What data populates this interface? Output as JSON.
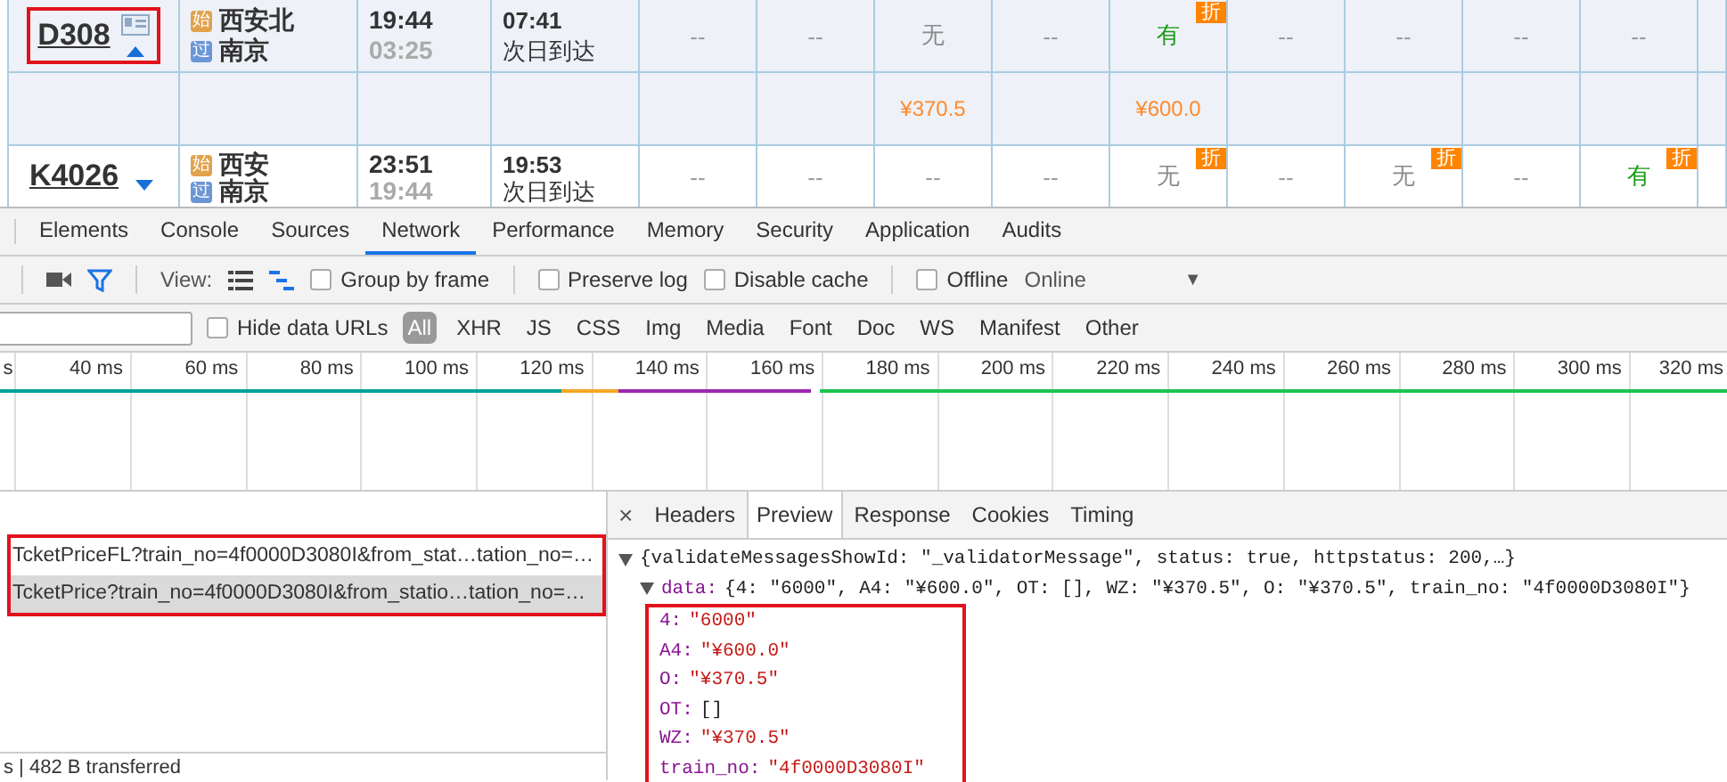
{
  "trains": [
    {
      "number": "D308",
      "info_icon": true,
      "expanded": true,
      "annotated": true,
      "from": {
        "badge": "始",
        "name": "西安北"
      },
      "to": {
        "badge": "过",
        "name": "南京"
      },
      "depart": "19:44",
      "duration": "03:25",
      "arrive": "07:41",
      "arrive_note": "次日到达",
      "seats": [
        {
          "text": "--",
          "kind": "dash"
        },
        {
          "text": "--",
          "kind": "dash"
        },
        {
          "text": "无",
          "kind": "none",
          "price": "¥370.5"
        },
        {
          "text": "--",
          "kind": "dash"
        },
        {
          "text": "有",
          "kind": "available",
          "discount": "折",
          "price": "¥600.0"
        },
        {
          "text": "--",
          "kind": "dash"
        },
        {
          "text": "--",
          "kind": "dash"
        },
        {
          "text": "--",
          "kind": "dash"
        },
        {
          "text": "--",
          "kind": "dash"
        }
      ]
    },
    {
      "number": "K4026",
      "info_icon": false,
      "expanded": false,
      "annotated": false,
      "from": {
        "badge": "始",
        "name": "西安"
      },
      "to": {
        "badge": "过",
        "name": "南京"
      },
      "depart": "23:51",
      "duration": "19:44",
      "arrive": "19:53",
      "arrive_note": "次日到达",
      "seats": [
        {
          "text": "--",
          "kind": "dash"
        },
        {
          "text": "--",
          "kind": "dash"
        },
        {
          "text": "--",
          "kind": "dash"
        },
        {
          "text": "--",
          "kind": "dash"
        },
        {
          "text": "无",
          "kind": "none",
          "discount": "折"
        },
        {
          "text": "--",
          "kind": "dash"
        },
        {
          "text": "无",
          "kind": "none",
          "discount": "折"
        },
        {
          "text": "--",
          "kind": "dash"
        },
        {
          "text": "有",
          "kind": "available",
          "discount": "折"
        }
      ]
    }
  ],
  "devtools": {
    "tabs": [
      {
        "label": "Elements",
        "selected": false
      },
      {
        "label": "Console",
        "selected": false
      },
      {
        "label": "Sources",
        "selected": false
      },
      {
        "label": "Network",
        "selected": true
      },
      {
        "label": "Performance",
        "selected": false
      },
      {
        "label": "Memory",
        "selected": false
      },
      {
        "label": "Security",
        "selected": false
      },
      {
        "label": "Application",
        "selected": false
      },
      {
        "label": "Audits",
        "selected": false
      }
    ],
    "filter_active": true,
    "view_label": "View:",
    "view_modes": [
      {
        "selected": false
      },
      {
        "selected": true
      }
    ],
    "checkboxes": [
      {
        "label": "Group by frame",
        "checked": false
      },
      {
        "label": "Preserve log",
        "checked": false
      },
      {
        "label": "Disable cache",
        "checked": false
      },
      {
        "label": "Offline",
        "checked": false
      }
    ],
    "throttle": {
      "value": "Online",
      "caret": "▼"
    },
    "hide_data_urls": {
      "label": "Hide data URLs",
      "checked": false
    },
    "types": [
      {
        "label": "All",
        "selected": true
      },
      {
        "label": "XHR",
        "selected": false
      },
      {
        "label": "JS",
        "selected": false
      },
      {
        "label": "CSS",
        "selected": false
      },
      {
        "label": "Img",
        "selected": false
      },
      {
        "label": "Media",
        "selected": false
      },
      {
        "label": "Font",
        "selected": false
      },
      {
        "label": "Doc",
        "selected": false
      },
      {
        "label": "WS",
        "selected": false
      },
      {
        "label": "Manifest",
        "selected": false
      },
      {
        "label": "Other",
        "selected": false
      }
    ],
    "ruler": [
      "s",
      "40 ms",
      "60 ms",
      "80 ms",
      "100 ms",
      "120 ms",
      "140 ms",
      "160 ms",
      "180 ms",
      "200 ms",
      "220 ms",
      "240 ms",
      "260 ms",
      "280 ms",
      "300 ms",
      "320 ms"
    ],
    "requests_annotated": true,
    "requests": [
      {
        "name": "TcketPriceFL?train_no=4f0000D3080I&from_stat…tation_no=…",
        "selected": false
      },
      {
        "name": "TcketPrice?train_no=4f0000D3080I&from_statio…tation_no=…",
        "selected": true
      }
    ],
    "status": "s | 482 B transferred",
    "preview": {
      "close": "×",
      "tabs": [
        {
          "label": "Headers",
          "selected": false
        },
        {
          "label": "Preview",
          "selected": true
        },
        {
          "label": "Response",
          "selected": false
        },
        {
          "label": "Cookies",
          "selected": false
        },
        {
          "label": "Timing",
          "selected": false
        }
      ],
      "root": {
        "text": "{validateMessagesShowId: \"_validatorMessage\", status: true, httpstatus: 200,…}",
        "expanded": true
      },
      "data": {
        "key": "data:",
        "summary": "{4: \"6000\", A4: \"¥600.0\", OT: [], WZ: \"¥370.5\", O: \"¥370.5\", train_no: \"4f0000D3080I\"}",
        "expanded": true,
        "annotated": true,
        "children": [
          {
            "key": "4:",
            "value": "\"6000\"",
            "kind": "string"
          },
          {
            "key": "A4:",
            "value": "\"¥600.0\"",
            "kind": "string"
          },
          {
            "key": "O:",
            "value": "\"¥370.5\"",
            "kind": "string"
          },
          {
            "key": "OT:",
            "value": "[]",
            "kind": "array"
          },
          {
            "key": "WZ:",
            "value": "\"¥370.5\"",
            "kind": "string"
          },
          {
            "key": "train_no:",
            "value": "\"4f0000D3080I\"",
            "kind": "string"
          }
        ]
      }
    }
  }
}
